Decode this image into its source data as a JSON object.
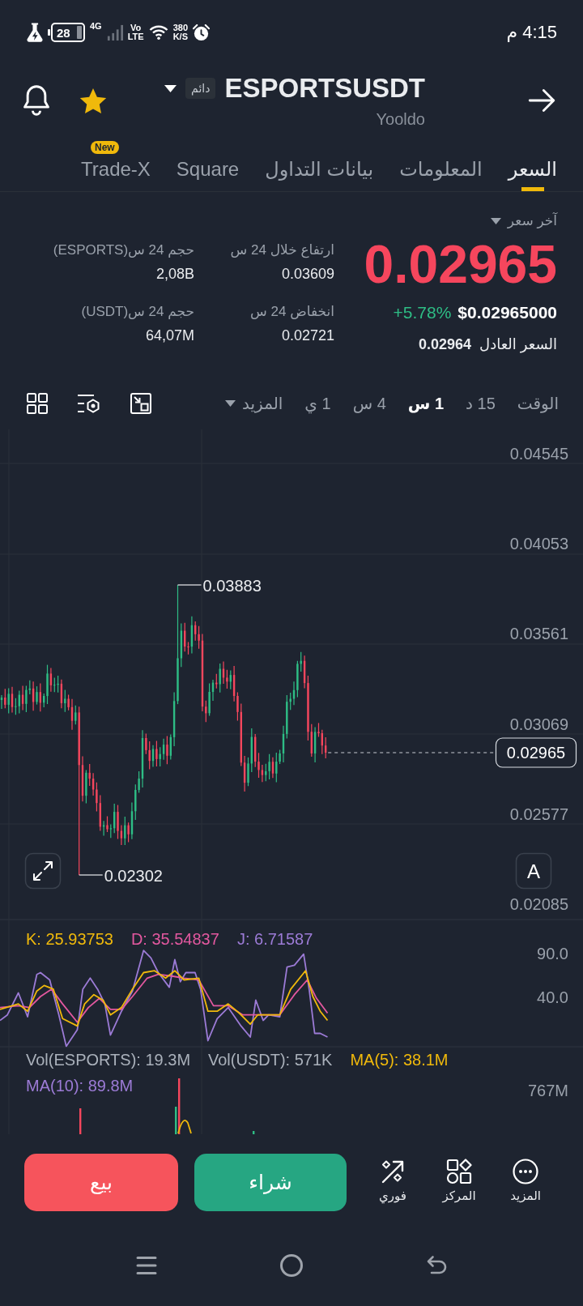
{
  "status_bar": {
    "time": "4:15 م",
    "battery": "28",
    "network": "4G",
    "volte": "Vo LTE",
    "speed": "380 K/S"
  },
  "header": {
    "symbol": "ESPORTSUSDT",
    "badge": "دائم",
    "subtitle": "Yooldo",
    "favorite": true
  },
  "tabs": [
    {
      "label": "السعر",
      "selected": true
    },
    {
      "label": "المعلومات",
      "selected": false
    },
    {
      "label": "بيانات التداول",
      "selected": false
    },
    {
      "label": "Square",
      "selected": false
    },
    {
      "label": "Trade-X",
      "selected": false,
      "badge": "New"
    }
  ],
  "price": {
    "label": "آخر سعر",
    "last": "0.02965",
    "last_falling": true,
    "usd": "$0.02965000",
    "change": "+5.78%",
    "change_rising": true,
    "fair_label": "السعر العادل",
    "fair_value": "0.02964",
    "stats": [
      {
        "label": "ارتفاع خلال 24 س",
        "value": "0.03609"
      },
      {
        "label": "حجم 24 س(ESPORTS)",
        "value": "2,08B"
      },
      {
        "label": "انخفاض 24 س",
        "value": "0.02721"
      },
      {
        "label": "حجم 24 س(USDT)",
        "value": "64,07M"
      }
    ]
  },
  "timeframes": {
    "label": "الوقت",
    "items": [
      {
        "label": "15 د",
        "selected": false
      },
      {
        "label": "1 س",
        "selected": true
      },
      {
        "label": "4 س",
        "selected": false
      },
      {
        "label": "1 ي",
        "selected": false
      }
    ],
    "more": "المزيد"
  },
  "chart": {
    "price_axis": [
      "0.04545",
      "0.04053",
      "0.03561",
      "0.03069",
      "0.02577",
      "0.02085"
    ],
    "high": "0.03883",
    "low": "0.02302",
    "current_price": "0.02965",
    "auto_button": "A"
  },
  "kdj": {
    "values": [
      {
        "label": "J: 6.71587",
        "color": "#9c7bd6"
      },
      {
        "label": "D: 35.54837",
        "color": "#e3589f"
      },
      {
        "label": "K: 25.93753",
        "color": "#f0b90b"
      }
    ],
    "axis": [
      "90.0",
      "40.0"
    ]
  },
  "volume": {
    "values": [
      {
        "label": "MA(5): 38.1M",
        "color": "#f0b90b"
      },
      {
        "label": "Vol(USDT): 571K",
        "color": "#aab1bb"
      },
      {
        "label": "Vol(ESPORTS): 19.3M",
        "color": "#aab1bb"
      },
      {
        "label": "MA(10): 89.8M",
        "color": "#9c7bd6"
      }
    ],
    "axis": [
      "767M"
    ]
  },
  "actions": {
    "shortcuts": [
      {
        "label": "المزيد",
        "kind": "more"
      },
      {
        "label": "المركز",
        "kind": "positions"
      },
      {
        "label": "فوري",
        "kind": "instant"
      }
    ],
    "buttons": [
      {
        "label": "شراء",
        "kind": "buy"
      },
      {
        "label": "بيع",
        "kind": "sell"
      }
    ]
  }
}
